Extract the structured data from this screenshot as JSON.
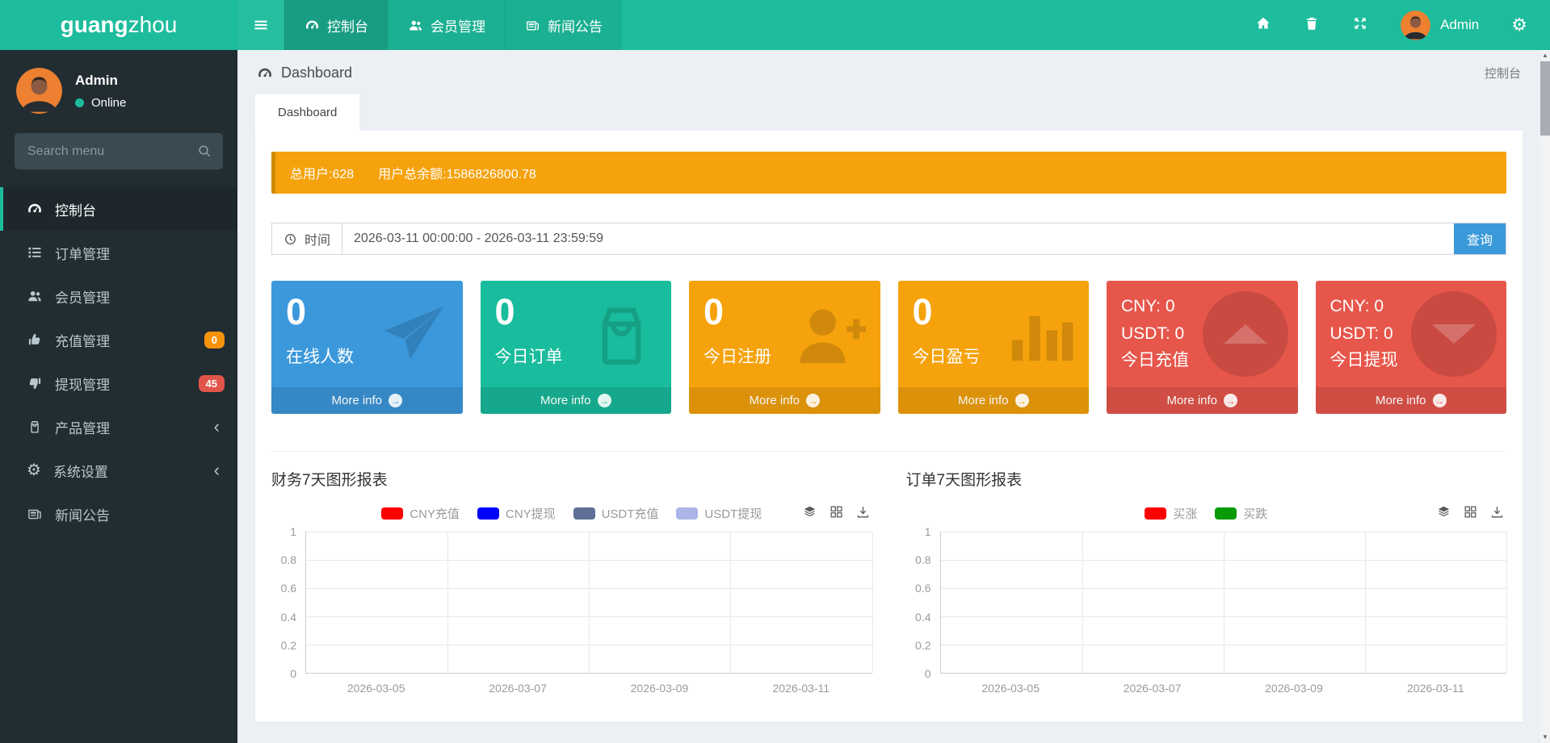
{
  "navbar": {
    "brand": {
      "bold": "guang",
      "regular": "zhou"
    },
    "menu_toggle_icon": "menu-icon",
    "tabs": [
      {
        "label": "控制台",
        "icon": "gauge-icon",
        "active": true
      },
      {
        "label": "会员管理",
        "icon": "users-icon",
        "active": false
      },
      {
        "label": "新闻公告",
        "icon": "newspaper-icon",
        "active": false
      }
    ],
    "right_icons": [
      "home-icon",
      "trash-icon",
      "expand-icon",
      "gears-icon"
    ],
    "user_name": "Admin"
  },
  "sidebar": {
    "user": {
      "name": "Admin",
      "status": "Online",
      "status_color": "#1dbc9c"
    },
    "search_placeholder": "Search menu",
    "items": [
      {
        "label": "控制台",
        "icon": "gauge-icon",
        "active": true
      },
      {
        "label": "订单管理",
        "icon": "list-icon"
      },
      {
        "label": "会员管理",
        "icon": "users-icon"
      },
      {
        "label": "充值管理",
        "icon": "hand-up-icon",
        "badge": "0",
        "badge_color": "#f6920b"
      },
      {
        "label": "提现管理",
        "icon": "hand-down-icon",
        "badge": "45",
        "badge_color": "#e15449"
      },
      {
        "label": "产品管理",
        "icon": "bag-icon",
        "expandable": true
      },
      {
        "label": "系统设置",
        "icon": "gears-icon",
        "expandable": true
      },
      {
        "label": "新闻公告",
        "icon": "newspaper-icon"
      }
    ]
  },
  "page": {
    "breadcrumb_title": "Dashboard",
    "breadcrumb_icon": "gauge-icon",
    "breadcrumb_right": "控制台",
    "tab_label": "Dashboard",
    "banner": {
      "total_users": "总用户:628",
      "total_balance": "用户总余额:1586826800.78",
      "color": "#f5a20c"
    },
    "time_filter": {
      "icon": "clock-icon",
      "label": "时间",
      "value": "2026-03-11 00:00:00 - 2026-03-11 23:59:59",
      "button_label": "查询",
      "button_color": "#3a99d9"
    },
    "more_info_label": "More info",
    "info_boxes": [
      {
        "value": "0",
        "label": "在线人数",
        "icon": "paper-plane-icon",
        "color": "#3b98db"
      },
      {
        "value": "0",
        "label": "今日订单",
        "icon": "shopping-bag-icon",
        "color": "#19bc9c"
      },
      {
        "value": "0",
        "label": "今日注册",
        "icon": "user-plus-icon",
        "color": "#f5a20c"
      },
      {
        "value": "0",
        "label": "今日盈亏",
        "icon": "bar-chart-icon",
        "color": "#f5a20c"
      },
      {
        "lines": [
          "CNY:  0",
          "USDT:  0",
          "今日充值"
        ],
        "icon": "circle-up-icon",
        "color": "#e7564b"
      },
      {
        "lines": [
          "CNY:  0",
          "USDT:  0",
          "今日提现"
        ],
        "icon": "circle-down-icon",
        "color": "#e7564b"
      }
    ]
  },
  "chart_data": [
    {
      "type": "line",
      "title": "财务7天图形报表",
      "series": [
        {
          "name": "CNY充值",
          "color": "#ff0000",
          "values": []
        },
        {
          "name": "CNY提现",
          "color": "#0000ff",
          "values": []
        },
        {
          "name": "USDT充值",
          "color": "#5f6e96",
          "values": []
        },
        {
          "name": "USDT提现",
          "color": "#abb5e8",
          "values": []
        }
      ],
      "x_tick_labels": [
        "2026-03-05",
        "2026-03-07",
        "2026-03-09",
        "2026-03-11"
      ],
      "y_ticks": [
        "1",
        "0.8",
        "0.6",
        "0.4",
        "0.2",
        "0"
      ],
      "ylim": [
        0,
        1
      ],
      "grid": true,
      "legend_position": "top",
      "toolbox": [
        "stack-icon",
        "tiled-icon",
        "download-icon"
      ]
    },
    {
      "type": "line",
      "title": "订单7天图形报表",
      "series": [
        {
          "name": "买涨",
          "color": "#ff0000",
          "values": []
        },
        {
          "name": "买跌",
          "color": "#089b08",
          "values": []
        }
      ],
      "x_tick_labels": [
        "2026-03-05",
        "2026-03-07",
        "2026-03-09",
        "2026-03-11"
      ],
      "y_ticks": [
        "1",
        "0.8",
        "0.6",
        "0.4",
        "0.2",
        "0"
      ],
      "ylim": [
        0,
        1
      ],
      "grid": true,
      "legend_position": "top",
      "toolbox": [
        "stack-icon",
        "tiled-icon",
        "download-icon"
      ]
    }
  ]
}
